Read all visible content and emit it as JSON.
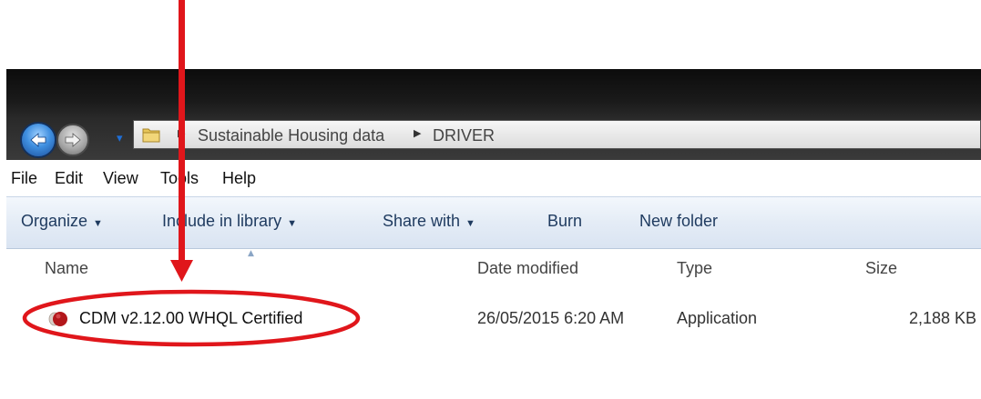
{
  "address": {
    "segments": [
      "Sustainable Housing data",
      "DRIVER"
    ]
  },
  "menu": {
    "items": [
      "File",
      "Edit",
      "View",
      "Tools",
      "Help"
    ]
  },
  "toolbar": {
    "organize": "Organize",
    "include_library": "Include in library",
    "share_with": "Share with",
    "burn": "Burn",
    "new_folder": "New folder"
  },
  "columns": {
    "name": "Name",
    "date": "Date modified",
    "type": "Type",
    "size": "Size"
  },
  "files": [
    {
      "name": "CDM v2.12.00 WHQL Certified",
      "date": "26/05/2015 6:20 AM",
      "type": "Application",
      "size": "2,188 KB"
    }
  ],
  "colors": {
    "annotation": "#e0161b",
    "toolbar_text": "#1e3a5f",
    "window_chrome": "#1a1a1a"
  }
}
